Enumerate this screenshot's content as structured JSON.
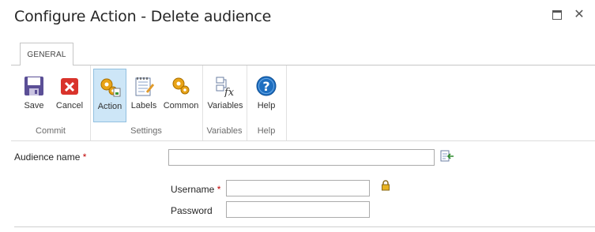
{
  "window": {
    "title": "Configure Action - Delete audience",
    "maximize_icon": "maximize-icon",
    "close_icon": "close-icon",
    "close_glyph": "✕"
  },
  "ribbon": {
    "tabs": [
      {
        "label": "GENERAL"
      }
    ],
    "groups": [
      {
        "label": "Commit",
        "buttons": [
          {
            "label": "Save",
            "icon": "save-icon"
          },
          {
            "label": "Cancel",
            "icon": "cancel-icon"
          }
        ]
      },
      {
        "label": "Settings",
        "buttons": [
          {
            "label": "Action",
            "icon": "action-gears-icon",
            "selected": true
          },
          {
            "label": "Labels",
            "icon": "labels-notepad-icon"
          },
          {
            "label": "Common",
            "icon": "common-gears-icon"
          }
        ]
      },
      {
        "label": "Variables",
        "buttons": [
          {
            "label": "Variables",
            "icon": "variables-fx-icon"
          }
        ]
      },
      {
        "label": "Help",
        "buttons": [
          {
            "label": "Help",
            "icon": "help-icon"
          }
        ]
      }
    ]
  },
  "form": {
    "audience_name": {
      "label": "Audience name",
      "required_marker": "*",
      "value": "",
      "side_icon": "insert-reference-icon"
    },
    "username": {
      "label": "Username",
      "required_marker": "*",
      "value": "",
      "side_icon": "lock-icon"
    },
    "password": {
      "label": "Password",
      "value": ""
    }
  },
  "colors": {
    "selected_button_bg": "#cde6f7",
    "required": "#bf0000",
    "help_icon_blue": "#1e6fc0",
    "cancel_red": "#d9332b"
  }
}
